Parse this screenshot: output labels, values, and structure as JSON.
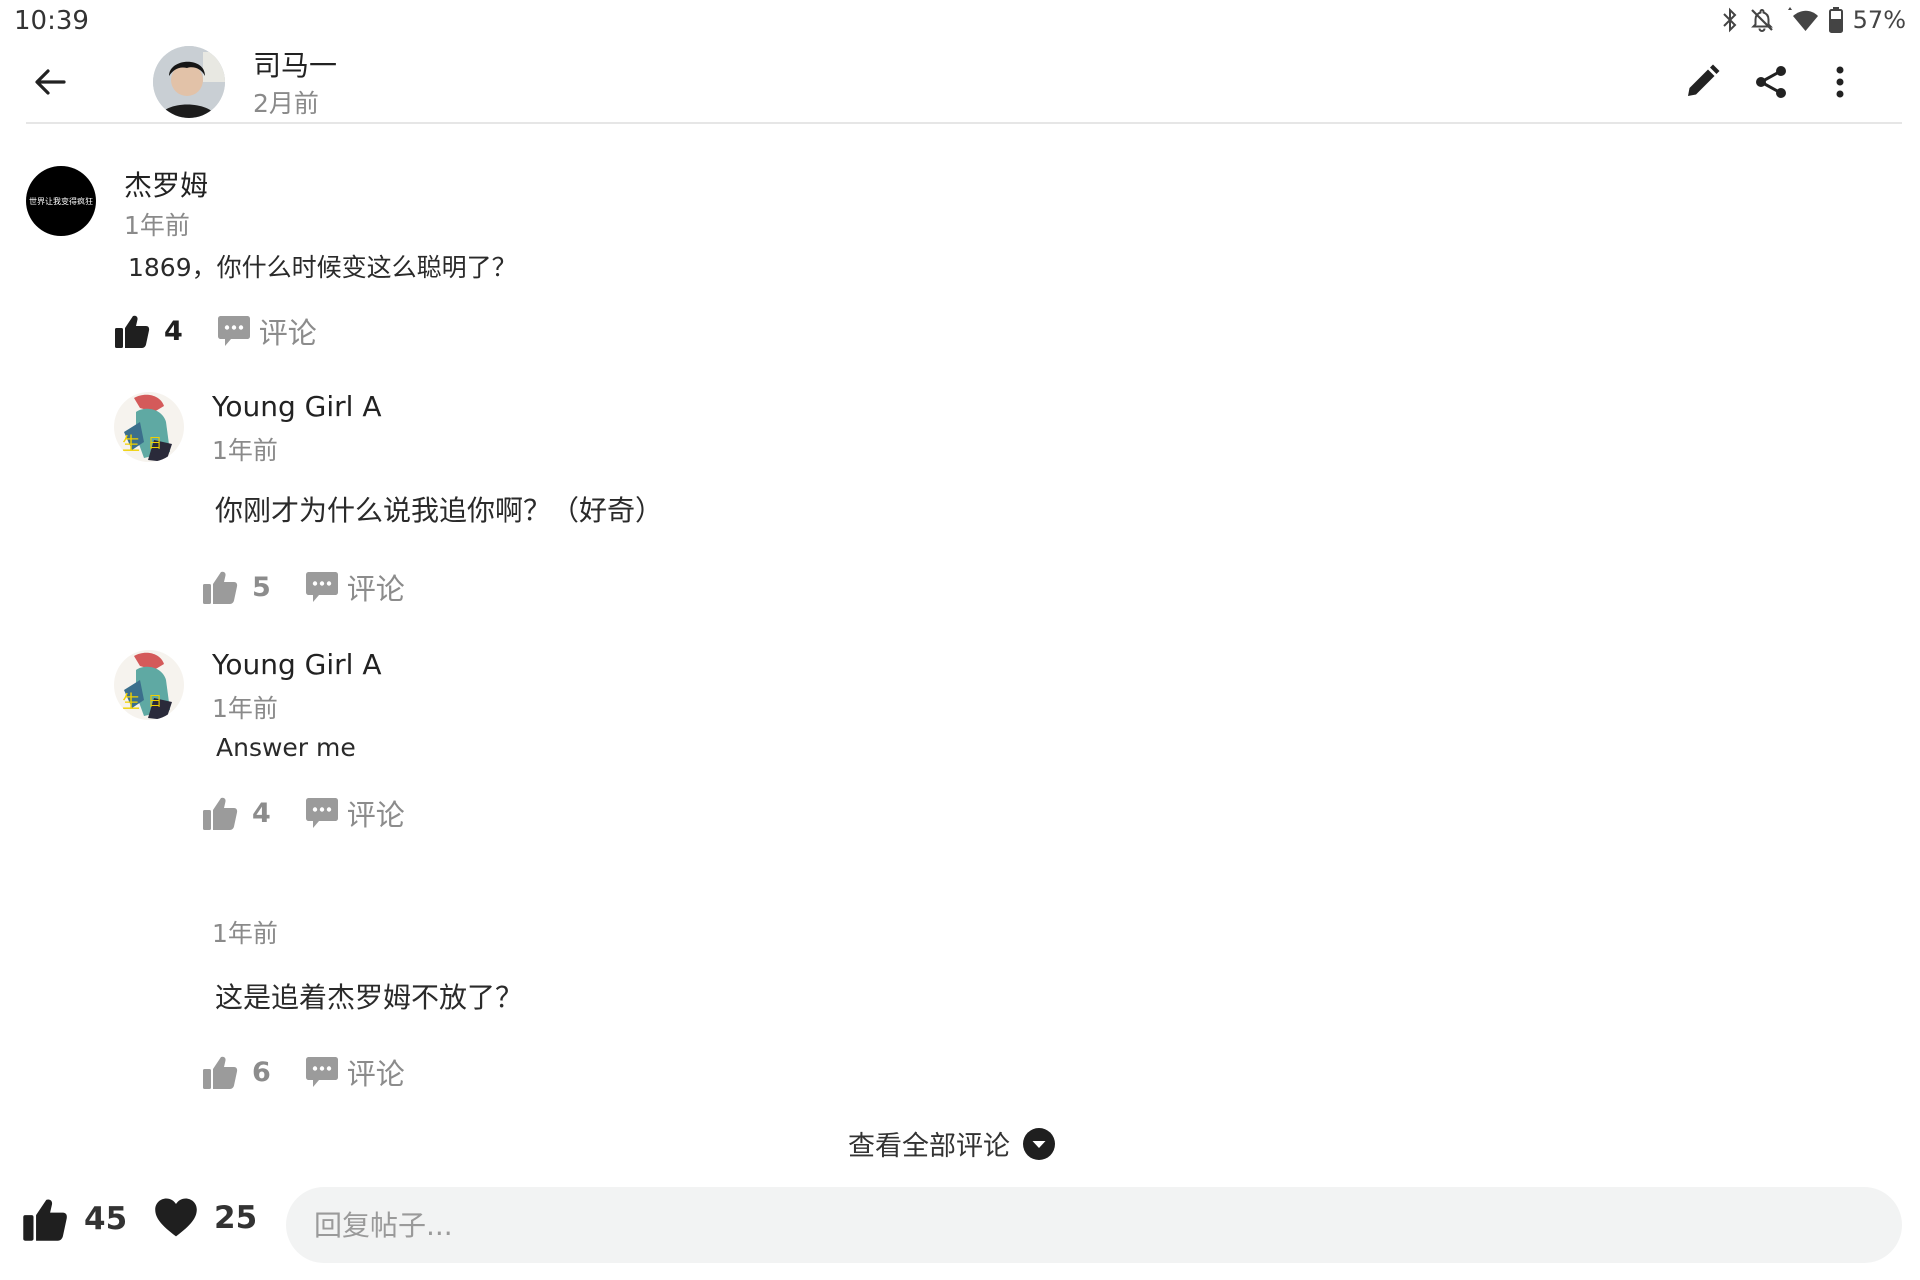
{
  "status_bar": {
    "time": "10:39",
    "battery": "57%"
  },
  "header": {
    "author": "司马一",
    "time": "2月前"
  },
  "comments": [
    {
      "name": "杰罗姆",
      "avatar_text": "世界让我变得疯狂",
      "time": "1年前",
      "text": "1869，你什么时候变这么聪明了？",
      "likes": "4",
      "comment_label": "评论",
      "liked": true
    }
  ],
  "replies": [
    {
      "name": "Young Girl A",
      "time": "1年前",
      "text": "你刚才为什么说我追你啊？（好奇）",
      "likes": "5",
      "comment_label": "评论"
    },
    {
      "name": "Young Girl A",
      "time": "1年前",
      "text": "Answer me",
      "likes": "4",
      "comment_label": "评论"
    },
    {
      "name": "",
      "time": "1年前",
      "text": "这是追着杰罗姆不放了？",
      "likes": "6",
      "comment_label": "评论"
    }
  ],
  "view_all": "查看全部评论",
  "bottom_bar": {
    "likes": "45",
    "favorites": "25",
    "reply_placeholder": "回复帖子..."
  },
  "colors": {
    "icon_dark": "#1f1f1f",
    "icon_gray": "#9b9b9b",
    "input_bg": "#f2f3f3"
  }
}
